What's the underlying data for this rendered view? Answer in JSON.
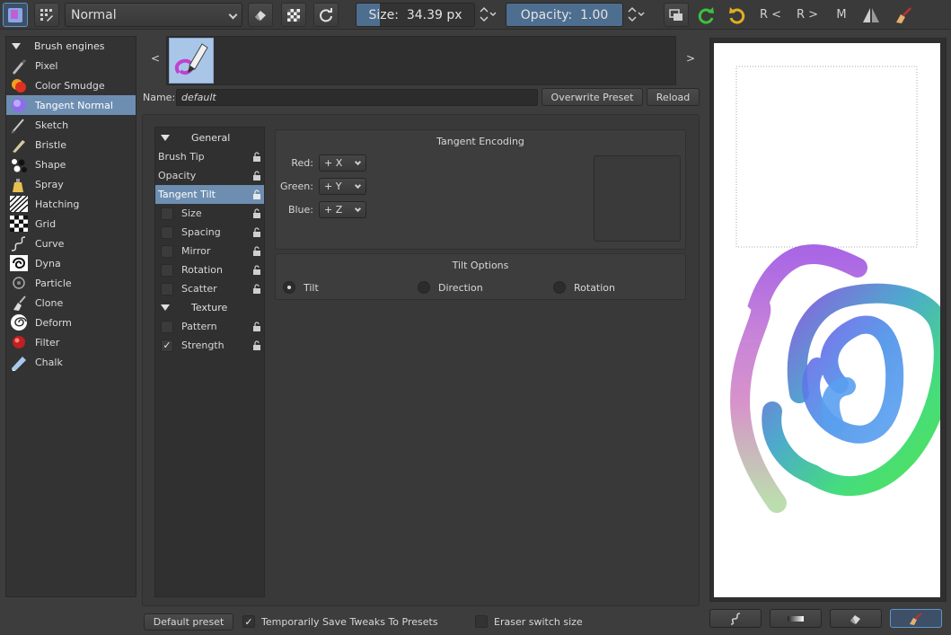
{
  "toolbar": {
    "blend_mode": "Normal",
    "size_label": "Size:",
    "size_value": "34.39 px",
    "size_fraction": 0.2,
    "opacity_label": "Opacity:",
    "opacity_value": "1.00",
    "opacity_fraction": 1.0,
    "reload_right_label": "R <",
    "reload_left_label": "R >",
    "mirror_label": "M"
  },
  "engines": {
    "header": "Brush engines",
    "items": [
      {
        "label": "Pixel",
        "icon": "pixel-brush-icon"
      },
      {
        "label": "Color Smudge",
        "icon": "color-smudge-icon"
      },
      {
        "label": "Tangent Normal",
        "icon": "tangent-normal-icon",
        "selected": true
      },
      {
        "label": "Sketch",
        "icon": "sketch-brush-icon"
      },
      {
        "label": "Bristle",
        "icon": "bristle-brush-icon"
      },
      {
        "label": "Shape",
        "icon": "shape-brush-icon"
      },
      {
        "label": "Spray",
        "icon": "spray-brush-icon"
      },
      {
        "label": "Hatching",
        "icon": "hatching-brush-icon"
      },
      {
        "label": "Grid",
        "icon": "grid-brush-icon"
      },
      {
        "label": "Curve",
        "icon": "curve-brush-icon"
      },
      {
        "label": "Dyna",
        "icon": "dyna-brush-icon"
      },
      {
        "label": "Particle",
        "icon": "particle-brush-icon"
      },
      {
        "label": "Clone",
        "icon": "clone-brush-icon"
      },
      {
        "label": "Deform",
        "icon": "deform-brush-icon"
      },
      {
        "label": "Filter",
        "icon": "filter-brush-icon"
      },
      {
        "label": "Chalk",
        "icon": "chalk-brush-icon"
      }
    ]
  },
  "preset": {
    "prev_arrow": "<",
    "next_arrow": ">",
    "name_label": "Name:",
    "name_value": "default",
    "overwrite_button": "Overwrite Preset",
    "reload_button": "Reload"
  },
  "options": {
    "general_header": "General",
    "brush_tip": "Brush Tip",
    "opacity": "Opacity",
    "tangent_tilt": "Tangent Tilt",
    "size": "Size",
    "spacing": "Spacing",
    "mirror": "Mirror",
    "rotation": "Rotation",
    "scatter": "Scatter",
    "texture_header": "Texture",
    "pattern": "Pattern",
    "strength": "Strength",
    "strength_checked": "✓"
  },
  "tangent_encoding": {
    "title": "Tangent Encoding",
    "red_label": "Red:",
    "red_value": "+ X",
    "green_label": "Green:",
    "green_value": "+ Y",
    "blue_label": "Blue:",
    "blue_value": "+ Z"
  },
  "tilt_options": {
    "title": "Tilt Options",
    "tilt": "Tilt",
    "direction": "Direction",
    "rotation": "Rotation"
  },
  "bottom": {
    "default_preset_button": "Default preset",
    "save_tweaks_label": "Temporarily Save Tweaks To Presets",
    "save_tweaks_checked": "✓",
    "eraser_switch_label": "Eraser switch size"
  },
  "colors": {
    "accent": "#6d8eb1",
    "slider_fill": "#4e6e90",
    "background": "#3d3d3d"
  }
}
